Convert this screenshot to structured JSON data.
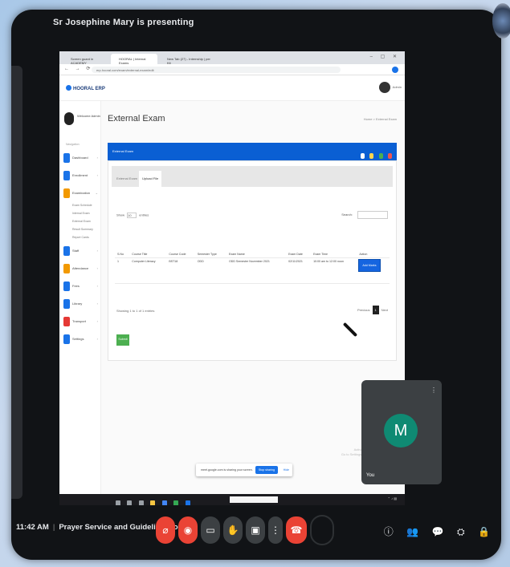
{
  "meet": {
    "presenting_text": "Sr Josephine Mary is presenting",
    "time": "11:42 AM",
    "meeting_title": "Prayer Service and Guidelines for S...",
    "self_label": "You",
    "self_initial": "M",
    "more_icon": "⋮",
    "controls": {
      "mic": "mic-off-icon",
      "cam": "camera-off-icon",
      "captions": "captions-icon",
      "hand": "raise-hand-icon",
      "present": "present-icon",
      "more": "more-icon",
      "leave": "leave-call-icon"
    },
    "right_controls": [
      "ⓘ",
      "👥",
      "💬",
      "⛭",
      "🔒"
    ],
    "accent_red": "#ea4335",
    "self_tile_color": "#0f8a73"
  },
  "browser": {
    "tabs": [
      "Screen guard in ACADEMY",
      "HOORAL | Internal Exams",
      "New Tab (27) - Internship | per Kit"
    ],
    "url": "erp.hooral.com/exam/external-exam/edit"
  },
  "app": {
    "logo": "HOORAL ERP",
    "user_name": "Admin",
    "welcome": "Welcome Admin",
    "menu_header": "Navigation",
    "menu_items": [
      "Dashboard",
      "Enrollment",
      "Examination",
      "Staff",
      "Attendance",
      "Fees",
      "Library",
      "Transport",
      "Settings"
    ],
    "submenu": [
      "Exam Schedule",
      "Internal Exam",
      "External Exam",
      "Result Summary",
      "Report Cards"
    ],
    "page_title": "External Exam",
    "breadcrumb": "Home > External Exam",
    "bar_title": "External Exam",
    "tabs": [
      "External Exam",
      "Upload File"
    ],
    "show_label": "Show",
    "show_value": "10",
    "entries_label": "entries",
    "search_label": "Search:",
    "table": {
      "headers": [
        "S.No",
        "Course Title",
        "Course Code",
        "Semester Type",
        "Exam Name",
        "Exam Date",
        "Exam Time",
        "Action"
      ],
      "rows": [
        [
          "1",
          "Computer Literacy",
          "BST18",
          "ODD",
          "ODD Semester November 2021",
          "02/11/2021",
          "10:00 am to 12:00 noon",
          "Add Marks"
        ]
      ]
    },
    "showing": "Showing 1 to 1 of 1 entries",
    "prev": "Previous",
    "page": "1",
    "next": "Next",
    "submit": "Submit",
    "watermark": "Activate Windows\nGo to Settings to activate Windows."
  },
  "share_banner": {
    "text": "meet.google.com is sharing your screen.",
    "stop": "Stop sharing",
    "hide": "Hide"
  }
}
